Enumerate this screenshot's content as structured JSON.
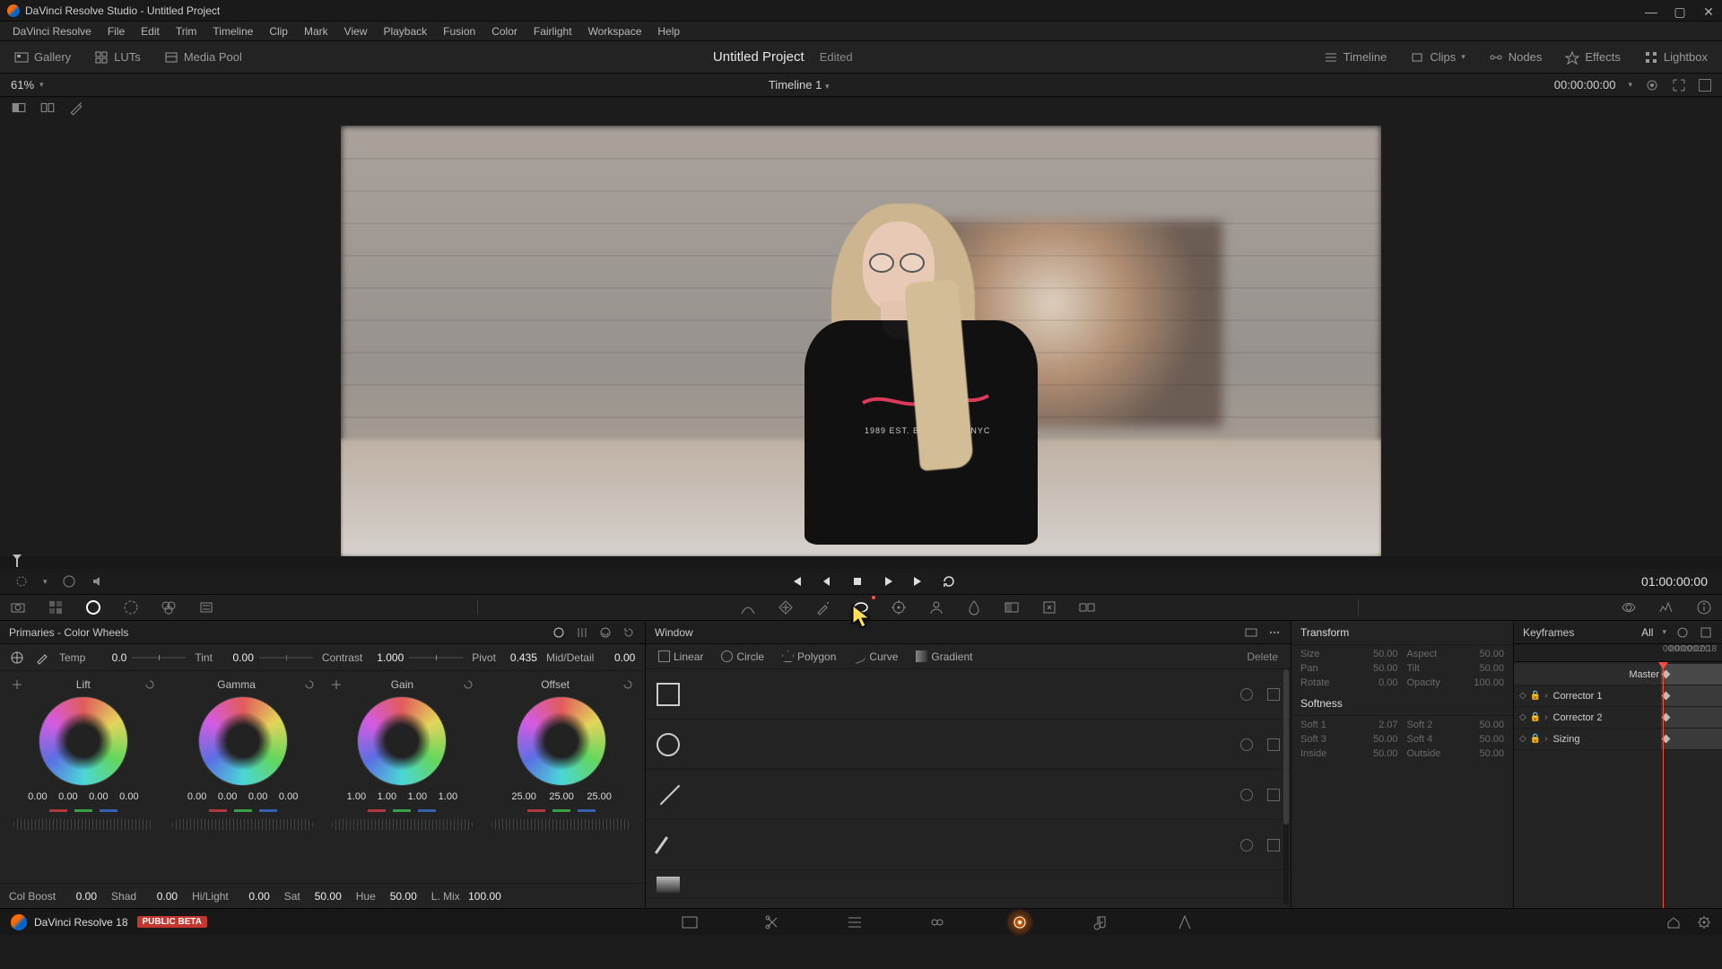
{
  "app": {
    "title": "DaVinci Resolve Studio - Untitled Project",
    "version_label": "DaVinci Resolve 18",
    "beta_badge": "PUBLIC BETA"
  },
  "menus": [
    "DaVinci Resolve",
    "File",
    "Edit",
    "Trim",
    "Timeline",
    "Clip",
    "Mark",
    "View",
    "Playback",
    "Fusion",
    "Color",
    "Fairlight",
    "Workspace",
    "Help"
  ],
  "toolbar": {
    "left": [
      {
        "icon": "gallery-icon",
        "label": "Gallery"
      },
      {
        "icon": "luts-icon",
        "label": "LUTs"
      },
      {
        "icon": "mediapool-icon",
        "label": "Media Pool"
      }
    ],
    "project_title": "Untitled Project",
    "project_status": "Edited",
    "right": [
      {
        "icon": "timeline-icon",
        "label": "Timeline"
      },
      {
        "icon": "clips-icon",
        "label": "Clips"
      },
      {
        "icon": "nodes-icon",
        "label": "Nodes"
      },
      {
        "icon": "effects-icon",
        "label": "Effects"
      },
      {
        "icon": "lightbox-icon",
        "label": "Lightbox"
      }
    ]
  },
  "viewer": {
    "zoom": "61%",
    "timeline_name": "Timeline 1",
    "source_tc": "00:00:00:00",
    "record_tc": "01:00:00:00",
    "shirt_text": "1989 EST. BROOKLYN, NYC"
  },
  "primaries": {
    "title": "Primaries - Color Wheels",
    "params": {
      "temp": {
        "label": "Temp",
        "value": "0.0"
      },
      "tint": {
        "label": "Tint",
        "value": "0.00"
      },
      "contrast": {
        "label": "Contrast",
        "value": "1.000"
      },
      "pivot": {
        "label": "Pivot",
        "value": "0.435"
      },
      "middetail": {
        "label": "Mid/Detail",
        "value": "0.00"
      }
    },
    "wheels": {
      "lift": {
        "name": "Lift",
        "vals": [
          "0.00",
          "0.00",
          "0.00",
          "0.00"
        ]
      },
      "gamma": {
        "name": "Gamma",
        "vals": [
          "0.00",
          "0.00",
          "0.00",
          "0.00"
        ]
      },
      "gain": {
        "name": "Gain",
        "vals": [
          "1.00",
          "1.00",
          "1.00",
          "1.00"
        ]
      },
      "offset": {
        "name": "Offset",
        "vals": [
          "25.00",
          "25.00",
          "25.00"
        ]
      }
    },
    "bottom": {
      "colboost": {
        "label": "Col Boost",
        "value": "0.00"
      },
      "shad": {
        "label": "Shad",
        "value": "0.00"
      },
      "hilight": {
        "label": "Hi/Light",
        "value": "0.00"
      },
      "sat": {
        "label": "Sat",
        "value": "50.00"
      },
      "hue": {
        "label": "Hue",
        "value": "50.00"
      },
      "lmix": {
        "label": "L. Mix",
        "value": "100.00"
      }
    }
  },
  "windowp": {
    "title": "Window",
    "shapes": {
      "linear": "Linear",
      "circle": "Circle",
      "polygon": "Polygon",
      "curve": "Curve",
      "gradient": "Gradient",
      "delete": "Delete"
    }
  },
  "transform": {
    "title": "Transform",
    "fields": {
      "size": {
        "label": "Size",
        "value": "50.00"
      },
      "aspect": {
        "label": "Aspect",
        "value": "50.00"
      },
      "pan": {
        "label": "Pan",
        "value": "50.00"
      },
      "tilt": {
        "label": "Tilt",
        "value": "50.00"
      },
      "rotate": {
        "label": "Rotate",
        "value": "0.00"
      },
      "opacity": {
        "label": "Opacity",
        "value": "100.00"
      }
    },
    "softness_title": "Softness",
    "softness": {
      "soft1": {
        "label": "Soft 1",
        "value": "2.07"
      },
      "soft2": {
        "label": "Soft 2",
        "value": "50.00"
      },
      "soft3": {
        "label": "Soft 3",
        "value": "50.00"
      },
      "soft4": {
        "label": "Soft 4",
        "value": "50.00"
      },
      "inside": {
        "label": "Inside",
        "value": "50.00"
      },
      "outside": {
        "label": "Outside",
        "value": "50.00"
      }
    }
  },
  "keyframes": {
    "title": "Keyframes",
    "all_label": "All",
    "ruler_start": "00:00:00:00",
    "ruler_end": "00:00:02:18",
    "tracks": {
      "master": "Master",
      "c1": "Corrector 1",
      "c2": "Corrector 2",
      "sizing": "Sizing"
    }
  }
}
